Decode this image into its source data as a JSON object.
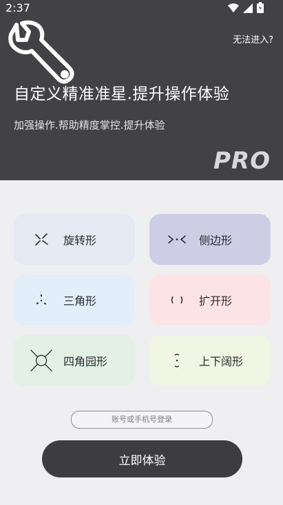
{
  "status_bar": {
    "time": "2:37",
    "icons": [
      "wifi-icon",
      "signal-icon",
      "battery-icon"
    ]
  },
  "header": {
    "help_link": "无法进入?",
    "headline": "自定义精准准星.提升操作体验",
    "subline": "加强操作.帮助精度掌控.提升体验",
    "badge": "PRO",
    "logo_icon": "wrench-icon"
  },
  "modes": [
    {
      "label": "旋转形",
      "icon": "rotate-crosshair-icon",
      "bg": "#e4e9f3"
    },
    {
      "label": "侧边形",
      "icon": "side-crosshair-icon",
      "bg": "#cdcde6"
    },
    {
      "label": "三角形",
      "icon": "triangle-crosshair-icon",
      "bg": "#e2eefa"
    },
    {
      "label": "扩开形",
      "icon": "bracket-crosshair-icon",
      "bg": "#fbe3e6"
    },
    {
      "label": "四角园形",
      "icon": "circle-crosshair-icon",
      "bg": "#e3f1e5"
    },
    {
      "label": "上下阔形",
      "icon": "vertical-crosshair-icon",
      "bg": "#f1f5e3"
    }
  ],
  "login": {
    "placeholder": "账号或手机号登录",
    "button_label": "立即体验"
  }
}
